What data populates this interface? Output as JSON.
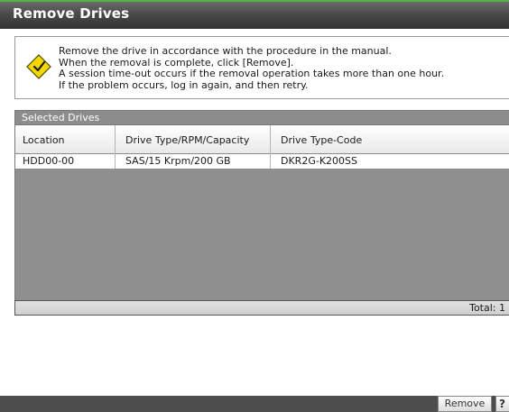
{
  "window": {
    "title": "Remove Drives"
  },
  "notice": {
    "icon": "warning-icon",
    "lines": [
      "Remove the drive in accordance with the procedure in the manual.",
      "When the removal is complete, click [Remove].",
      "A session time-out occurs if the removal operation takes more than one hour.",
      "If the problem occurs, log in again, and then retry."
    ]
  },
  "selected_drives": {
    "title": "Selected Drives",
    "columns": [
      "Location",
      "Drive Type/RPM/Capacity",
      "Drive Type-Code"
    ],
    "rows": [
      {
        "location": "HDD00-00",
        "drive": "SAS/15 Krpm/200 GB",
        "code": "DKR2G-K200SS"
      }
    ],
    "total_label": "Total: 1"
  },
  "footer": {
    "remove_label": "Remove",
    "help_label": "?"
  },
  "colors": {
    "title_accent": "#58b04a",
    "warning_yellow": "#f5d800"
  }
}
